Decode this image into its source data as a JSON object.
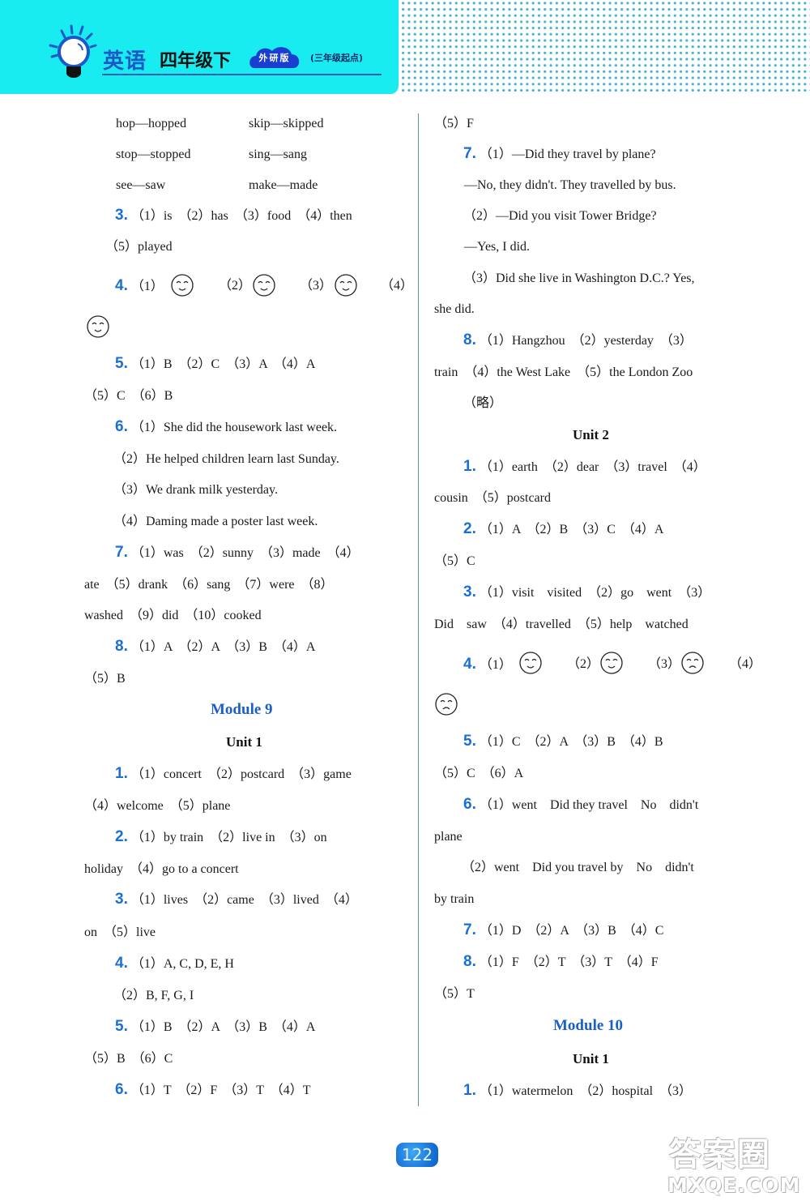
{
  "header": {
    "subject": "英语",
    "grade": "四年级下",
    "edition": "外研版",
    "start_note": "(三年级起点)",
    "accent_color": "#19ecf0",
    "brand_blue": "#1c58c8"
  },
  "left": {
    "verb_pairs": [
      [
        "hop—hopped",
        "skip—skipped"
      ],
      [
        "stop—stopped",
        "sing—sang"
      ],
      [
        "see—saw",
        "make—made"
      ]
    ],
    "q3": {
      "num": "3.",
      "line1": "（1）is　（2）has　（3）food　（4）then",
      "line2": "（5）played"
    },
    "q4": {
      "num": "4.",
      "labels": [
        "（1）",
        "（2）",
        "（3）",
        "（4）"
      ],
      "faces": [
        "smile",
        "smile",
        "smile",
        "smile"
      ]
    },
    "q5": {
      "num": "5.",
      "line1": "（1）B　（2）C　（3）A　（4）A",
      "line2": "（5）C　（6）B"
    },
    "q6": {
      "num": "6.",
      "items": [
        "（1）She did the housework last week.",
        "（2）He helped children learn last Sunday.",
        "（3）We drank milk yesterday.",
        "（4）Daming made a poster last week."
      ]
    },
    "q7": {
      "num": "7.",
      "line1": "（1）was　（2）sunny　（3）made　（4）",
      "line2": "ate　（5）drank　（6）sang　（7）were　（8）",
      "line3": "washed　（9）did　（10）cooked"
    },
    "q8": {
      "num": "8.",
      "line1": "（1）A　（2）A　（3）B　（4）A",
      "line2": "（5）B"
    },
    "module9": {
      "title": "Module 9",
      "unit": "Unit 1",
      "q1": {
        "num": "1.",
        "line1": "（1）concert　（2）postcard　（3）game",
        "line2": "（4）welcome　（5）plane"
      },
      "q2": {
        "num": "2.",
        "line1": "（1）by train　（2）live in　（3）on",
        "line2": "holiday　（4）go to a concert"
      },
      "q3": {
        "num": "3.",
        "line1": "（1）lives　（2）came　（3）lived　（4）",
        "line2": "on　（5）live"
      },
      "q4": {
        "num": "4.",
        "line1": "（1）A, C, D, E, H",
        "line2": "（2）B, F, G, I"
      },
      "q5": {
        "num": "5.",
        "line1": "（1）B　（2）A　（3）B　（4）A",
        "line2": "（5）B　（6）C"
      },
      "q6": {
        "num": "6.",
        "line1": "（1）T　（2）F　（3）T　（4）T"
      }
    }
  },
  "right": {
    "q6_cont": "（5）F",
    "q7": {
      "num": "7.",
      "lines": [
        "（1）—Did they travel by plane?",
        "—No, they didn't. They travelled by bus.",
        "（2）—Did you visit Tower Bridge?",
        "—Yes, I did.",
        "（3）Did she live in Washington D.C.? Yes,",
        "she did."
      ]
    },
    "q8": {
      "num": "8.",
      "line1": "（1）Hangzhou　（2）yesterday　（3）",
      "line2": "train　（4）the West Lake　（5）the London Zoo",
      "line3": "（略）"
    },
    "unit2": {
      "title": "Unit 2",
      "q1": {
        "num": "1.",
        "line1": "（1）earth　（2）dear　（3）travel　（4）",
        "line2": "cousin　（5）postcard"
      },
      "q2": {
        "num": "2.",
        "line1": "（1）A　（2）B　（3）C　（4）A",
        "line2": "（5）C"
      },
      "q3": {
        "num": "3.",
        "line1": "（1）visit　visited　（2）go　went　（3）",
        "line2": "Did　saw　（4）travelled　（5）help　watched"
      },
      "q4": {
        "num": "4.",
        "labels": [
          "（1）",
          "（2）",
          "（3）",
          "（4）"
        ],
        "faces": [
          "smile",
          "smile",
          "sad",
          "sad"
        ]
      },
      "q5": {
        "num": "5.",
        "line1": "（1）C　（2）A　（3）B　（4）B",
        "line2": "（5）C　（6）A"
      },
      "q6": {
        "num": "6.",
        "line1": "（1）went　Did they travel　No　didn't",
        "line2": "plane",
        "line3": "（2）went　Did you travel by　No　didn't",
        "line4": "by train"
      },
      "q7": {
        "num": "7.",
        "line1": "（1）D　（2）A　（3）B　（4）C"
      },
      "q8": {
        "num": "8.",
        "line1": "（1）F　（2）T　（3）T　（4）F",
        "line2": "（5）T"
      }
    },
    "module10": {
      "title": "Module 10",
      "unit": "Unit 1",
      "q1": {
        "num": "1.",
        "line1": "（1）watermelon　（2）hospital　（3）"
      }
    }
  },
  "footer": {
    "page_number": "122",
    "watermark_cn": "答案圈",
    "watermark_en": "MXQE.COM"
  }
}
